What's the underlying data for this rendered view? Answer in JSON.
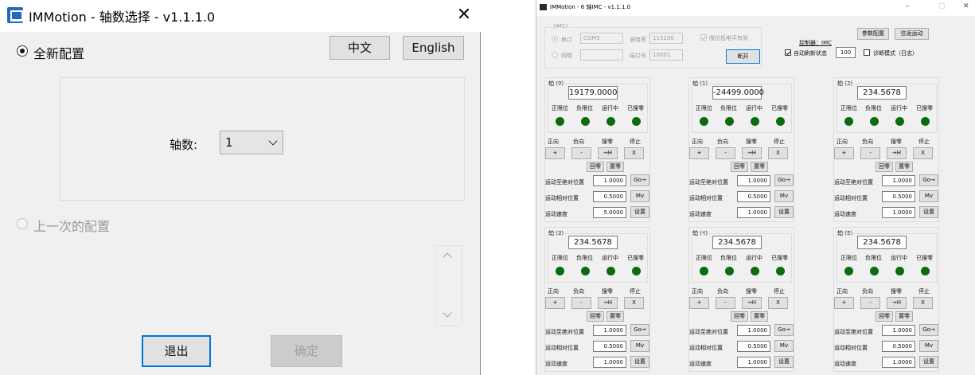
{
  "left_dialog": {
    "title": "IMMotion - 轴数选择 - v1.1.1.0",
    "close_glyph": "✕",
    "radio_new": "全新配置",
    "lang_zh": "中文",
    "lang_en": "English",
    "axis_label": "轴数:",
    "axis_value": "1",
    "radio_prev": "上一次的配置",
    "exit_button": "退出",
    "confirm_button": "确定",
    "scroll_up": "^",
    "scroll_down": "v"
  },
  "right_window": {
    "title": "IMMotion - 6 轴IMC - v1.1.1.0",
    "minimize": "–",
    "maximize": "□",
    "close": "✕",
    "comm": {
      "group_label": "(IMC)",
      "serial_label": "串口",
      "serial_port": "COM5",
      "baud_label": "波特率",
      "baud_value": "115200",
      "limit_check": "限位低电平有效",
      "network_label": "网络",
      "port_label": "端口号",
      "port_value": "10001",
      "disconnect": "断开"
    },
    "controller": {
      "label": "控制器：IMC",
      "param_button": "参数配置",
      "home_button": "往返运动",
      "auto_refresh": "自动刷新状态",
      "refresh_value": "100",
      "diag_mode": "诊断模式（日志）"
    },
    "axes": [
      {
        "title": "轴 (0)",
        "position": "19179.0000",
        "abs_value": "1.0000",
        "rel_value": "0.5000",
        "speed_value": "5.0000"
      },
      {
        "title": "轴 (1)",
        "position": "-24499.0000",
        "abs_value": "1.0000",
        "rel_value": "0.5000",
        "speed_value": "1.0000"
      },
      {
        "title": "轴 (2)",
        "position": "234.5678",
        "abs_value": "1.0000",
        "rel_value": "0.5000",
        "speed_value": "1.0000"
      },
      {
        "title": "轴 (3)",
        "position": "234.5678",
        "abs_value": "1.0000",
        "rel_value": "0.5000",
        "speed_value": "1.0000"
      },
      {
        "title": "轴 (4)",
        "position": "234.5678",
        "abs_value": "1.0000",
        "rel_value": "0.5000",
        "speed_value": "1.0000"
      },
      {
        "title": "轴 (5)",
        "position": "234.5678",
        "abs_value": "1.0000",
        "rel_value": "0.5000",
        "speed_value": "1.0000"
      }
    ],
    "axis_labels": {
      "pos_limit": "正限位",
      "neg_limit": "负限位",
      "running": "运行中",
      "homed": "已搜零",
      "forward": "正向",
      "backward": "负向",
      "search": "搜零",
      "stop": "停止",
      "plus": "+",
      "minus": "-",
      "search_btn": "→H",
      "stop_btn": "X",
      "return_zero": "回零",
      "set_zero": "置零",
      "move_abs": "运动至绝对位置",
      "move_rel": "运动相对位置",
      "speed": "运动速度",
      "go_btn": "Go→",
      "mv_btn": "Mv",
      "set_btn": "设置"
    },
    "led_color": "#0a6b12"
  }
}
